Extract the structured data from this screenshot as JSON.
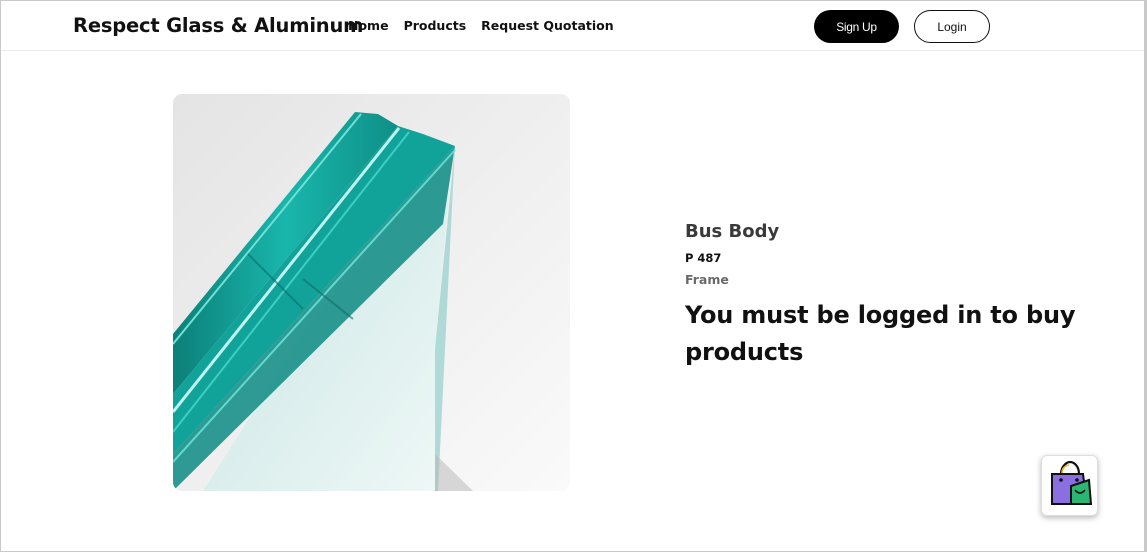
{
  "header": {
    "brand": "Respect Glass & Aluminum",
    "nav": [
      {
        "label": "Home"
      },
      {
        "label": "Products"
      },
      {
        "label": "Request Quotation"
      }
    ],
    "signup_label": "Sign Up",
    "login_label": "Login"
  },
  "product": {
    "title": "Bus Body",
    "code": "P 487",
    "category": "Frame",
    "login_message": "You must be logged in to buy products"
  },
  "icons": {
    "cart": "shopping-bag-icon"
  },
  "colors": {
    "primary_button": "#000000",
    "glass": "#14a69d",
    "cart_bag": "#8b6ee0"
  }
}
